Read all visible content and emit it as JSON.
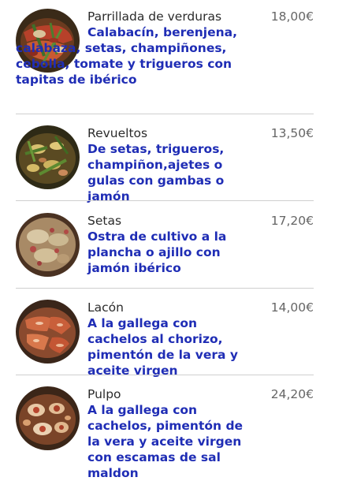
{
  "currency_symbol": "€",
  "colors": {
    "name": "#2b2b2b",
    "price": "#666666",
    "description": "#1f2db5",
    "divider": "#cfcfcf"
  },
  "dishes": [
    {
      "name": "Parrillada de verduras",
      "price": "18,00€",
      "description": "Calabacín, berenjena, calabaza, setas, champiñones, cebolla, tomate y trigueros con tapitas de ibérico",
      "photo_icon": "grilled-vegetables-photo"
    },
    {
      "name": "Revueltos",
      "price": "13,50€",
      "description": "De setas, trigueros, champiñon,ajetes o gulas con gambas o jamón",
      "photo_icon": "scrambled-eggs-photo"
    },
    {
      "name": "Setas",
      "price": "17,20€",
      "description": "Ostra de cultivo a la plancha o ajillo con jamón ibérico",
      "photo_icon": "mushrooms-photo"
    },
    {
      "name": "Lacón",
      "price": "14,00€",
      "description": "A la gallega con cachelos al chorizo, pimentón de la vera y aceite virgen",
      "photo_icon": "lacon-photo"
    },
    {
      "name": "Pulpo",
      "price": "24,20€",
      "description": "A la gallega con cachelos, pimentón de la vera y aceite virgen con escamas de sal maldon",
      "photo_icon": "octopus-photo"
    }
  ]
}
